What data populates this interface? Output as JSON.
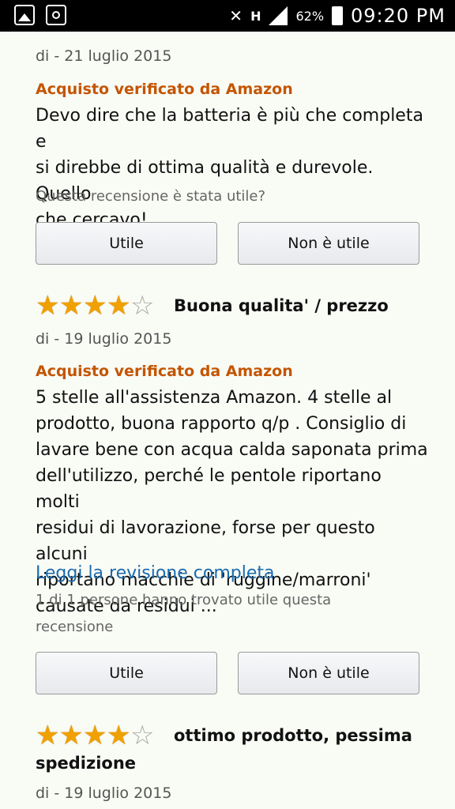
{
  "status_bar": {
    "battery": "62%",
    "time": "09:20 PM",
    "network": "H"
  },
  "reviews": [
    {
      "date": "di - 21 luglio 2015",
      "verified": "Acquisto verificato da Amazon",
      "lines": [
        "Devo dire che la batteria è più che completa e",
        "si direbbe di ottima qualità e durevole. Quello",
        "che cercavo!"
      ],
      "question": "Questa recensione è stata utile?",
      "helpful_label": "Utile",
      "not_helpful_label": "Non è utile"
    },
    {
      "rating": 4,
      "title": "Buona qualita' / prezzo",
      "date": "di - 19 luglio 2015",
      "verified": "Acquisto verificato da Amazon",
      "lines": [
        "5 stelle all'assistenza Amazon. 4 stelle al",
        "prodotto, buona rapporto q/p . Consiglio di",
        "lavare bene con acqua calda saponata prima",
        "dell'utilizzo, perché le pentole riportano molti",
        "residui di lavorazione, forse per questo alcuni",
        "riportano macchie di 'ruggine/marroni'",
        "causate da residui ..."
      ],
      "read_more": "Leggi la revisione completa",
      "helpful_count_lines": [
        "1 di 1 persone hanno trovato utile questa",
        "recensione"
      ],
      "helpful_label": "Utile",
      "not_helpful_label": "Non è utile"
    },
    {
      "rating": 4,
      "title_line1": "ottimo prodotto, pessima",
      "title_line2": "spedizione",
      "date": "di - 19 luglio 2015"
    }
  ]
}
